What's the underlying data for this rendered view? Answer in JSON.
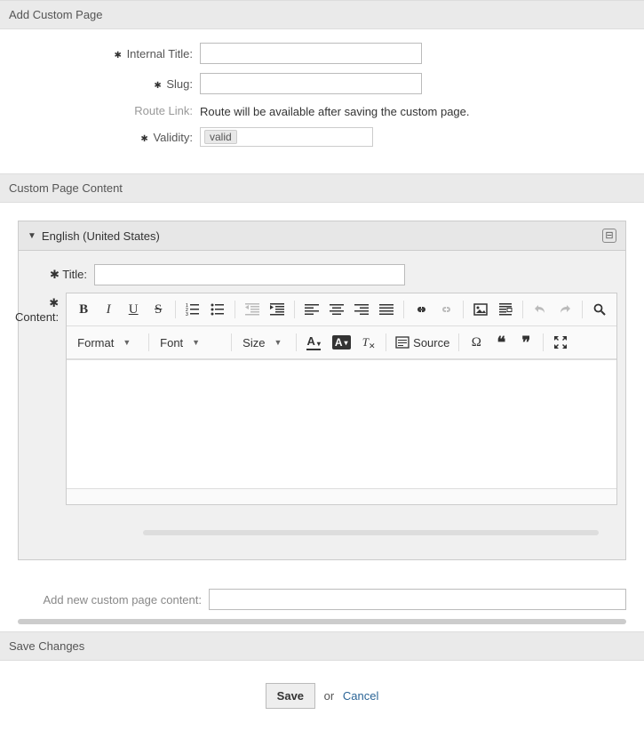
{
  "sections": {
    "add_custom_page": "Add Custom Page",
    "custom_page_content": "Custom Page Content",
    "save_changes": "Save Changes"
  },
  "labels": {
    "internal_title": "Internal Title:",
    "slug": "Slug:",
    "route_link": "Route Link:",
    "validity": "Validity:",
    "title": "Title:",
    "content": "Content:",
    "add_new_content": "Add new custom page content:"
  },
  "values": {
    "internal_title": "",
    "slug": "",
    "route_link_text": "Route will be available after saving the custom page.",
    "validity": "valid",
    "title": "",
    "add_new_content": ""
  },
  "accordion": {
    "language": "English (United States)"
  },
  "toolbar": {
    "format": "Format",
    "font": "Font",
    "size": "Size",
    "source": "Source"
  },
  "buttons": {
    "save": "Save",
    "or": "or",
    "cancel": "Cancel"
  }
}
